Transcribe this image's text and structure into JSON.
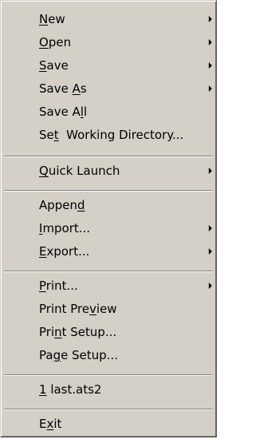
{
  "menu": {
    "items": [
      {
        "pre": "",
        "key": "N",
        "post": "ew",
        "submenu": true
      },
      {
        "pre": "",
        "key": "O",
        "post": "pen",
        "submenu": true
      },
      {
        "pre": "",
        "key": "S",
        "post": "ave",
        "submenu": true
      },
      {
        "pre": "Save ",
        "key": "A",
        "post": "s",
        "submenu": true
      },
      {
        "pre": "Save A",
        "key": "l",
        "post": "l",
        "submenu": false
      },
      {
        "pre": "Se",
        "key": "t",
        "post": "  Working Directory...",
        "submenu": false
      },
      {
        "pre": "",
        "key": "Q",
        "post": "uick Launch",
        "submenu": true
      },
      {
        "pre": "Appen",
        "key": "d",
        "post": "",
        "submenu": false
      },
      {
        "pre": "",
        "key": "I",
        "post": "mport...",
        "submenu": true
      },
      {
        "pre": "",
        "key": "E",
        "post": "xport...",
        "submenu": true
      },
      {
        "pre": "",
        "key": "P",
        "post": "rint...",
        "submenu": true
      },
      {
        "pre": "Print Pre",
        "key": "v",
        "post": "iew",
        "submenu": false
      },
      {
        "pre": "Pri",
        "key": "n",
        "post": "t Setup...",
        "submenu": false
      },
      {
        "pre": "Pa",
        "key": "g",
        "post": "e Setup...",
        "submenu": false
      },
      {
        "pre": "",
        "key": "1",
        "post": " last.ats2",
        "submenu": false
      },
      {
        "pre": "E",
        "key": "x",
        "post": "it",
        "submenu": false
      }
    ]
  }
}
